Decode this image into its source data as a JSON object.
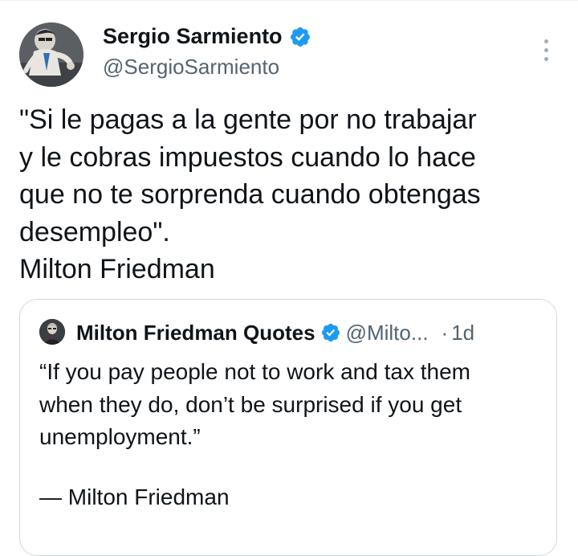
{
  "tweet": {
    "author_name": "Sergio Sarmiento",
    "author_handle": "@SergioSarmiento",
    "text_lines": [
      "\"Si le pagas a la gente por no trabajar",
      "y le cobras impuestos cuando lo hace",
      "que no te sorprenda cuando obtengas",
      "desempleo\".",
      "Milton Friedman"
    ]
  },
  "quoted": {
    "author_name": "Milton Friedman Quotes",
    "author_handle": "@Milto...",
    "separator": "·",
    "time": "1d",
    "text_lines": [
      "“If you pay people not to work and tax them",
      "when they do, don’t be surprised if you get",
      "unemployment.”"
    ],
    "attribution": "— Milton Friedman"
  },
  "colors": {
    "verified_badge": "#1d9bf0",
    "secondary_text": "#536471",
    "border": "#cfd9de"
  },
  "icons": {
    "verified": "verified-badge-icon",
    "more": "more-options-icon"
  }
}
